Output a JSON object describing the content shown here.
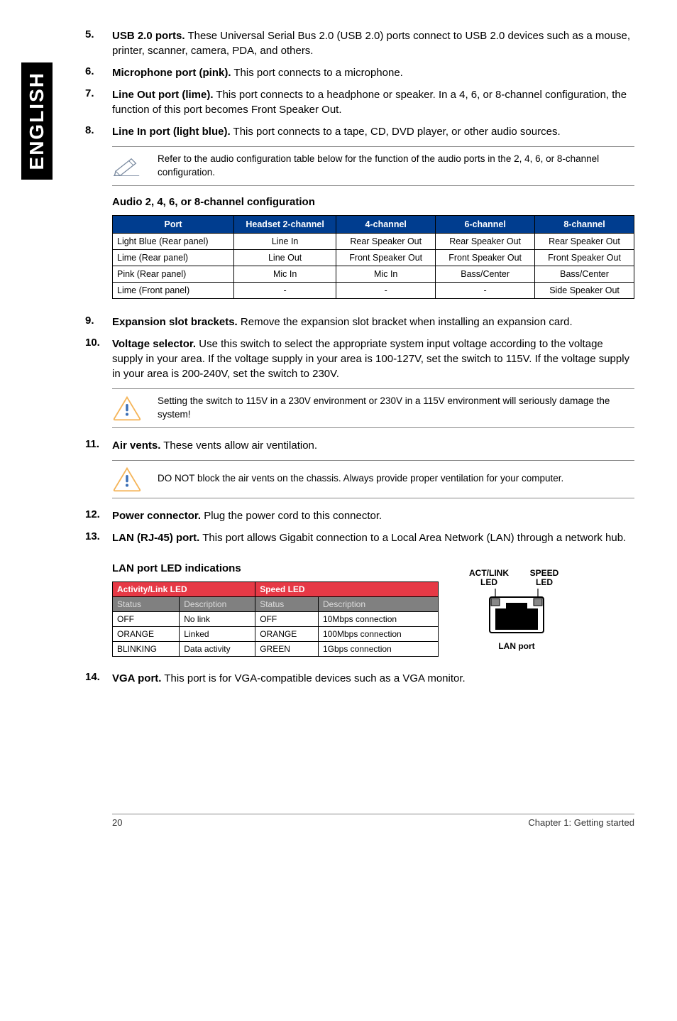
{
  "sidebar": {
    "label": "ENGLISH"
  },
  "items": {
    "5": {
      "num": "5.",
      "title": "USB 2.0 ports.",
      "text": "These Universal Serial Bus 2.0 (USB 2.0) ports connect to USB 2.0 devices such as a mouse, printer, scanner, camera, PDA, and others."
    },
    "6": {
      "num": "6.",
      "title": "Microphone port (pink).",
      "text": "This port connects to a microphone."
    },
    "7": {
      "num": "7.",
      "title": "Line Out port (lime).",
      "text": "This port connects to a headphone or speaker. In a 4, 6, or 8-channel configuration, the function of this port becomes Front Speaker Out."
    },
    "8": {
      "num": "8.",
      "title": "Line In port (light blue).",
      "text": "This port connects to a tape, CD, DVD player, or other audio sources."
    },
    "9": {
      "num": "9.",
      "title": "Expansion slot brackets.",
      "text": "Remove the expansion slot bracket when installing an expansion card."
    },
    "10": {
      "num": "10.",
      "title": "Voltage selector.",
      "text": "Use this switch to select the appropriate system input voltage according to the voltage supply in your area. If the voltage supply in your area is 100-127V, set the switch to 115V. If the voltage supply in your area is 200-240V, set the switch to 230V."
    },
    "11": {
      "num": "11.",
      "title": "Air vents.",
      "text": "These vents allow air ventilation."
    },
    "12": {
      "num": "12.",
      "title": "Power connector.",
      "text": "Plug the power cord to this connector."
    },
    "13": {
      "num": "13.",
      "title": "LAN (RJ-45) port.",
      "text": "This port allows Gigabit connection to a Local Area Network (LAN) through a network hub."
    },
    "14": {
      "num": "14.",
      "title": "VGA port.",
      "text": "This port is for VGA-compatible devices such as a VGA monitor."
    }
  },
  "notes": {
    "audio": "Refer to the audio configuration table below for the function of the audio ports in the 2, 4, 6, or 8-channel configuration.",
    "voltage": "Setting the switch to 115V in a 230V environment or 230V in a 115V environment will seriously damage the system!",
    "airvent": "DO NOT block the air vents on the chassis. Always provide proper ventilation for your computer."
  },
  "audio_table": {
    "title": "Audio 2, 4, 6, or 8-channel configuration",
    "headers": [
      "Port",
      "Headset 2-channel",
      "4-channel",
      "6-channel",
      "8-channel"
    ],
    "rows": [
      [
        "Light Blue (Rear panel)",
        "Line In",
        "Rear Speaker Out",
        "Rear Speaker Out",
        "Rear Speaker Out"
      ],
      [
        "Lime (Rear panel)",
        "Line Out",
        "Front Speaker Out",
        "Front Speaker Out",
        "Front Speaker Out"
      ],
      [
        "Pink (Rear panel)",
        "Mic In",
        "Mic In",
        "Bass/Center",
        "Bass/Center"
      ],
      [
        "Lime (Front panel)",
        "-",
        "-",
        "-",
        "Side Speaker Out"
      ]
    ]
  },
  "led": {
    "title": "LAN port LED indications",
    "top_headers": [
      "Activity/Link LED",
      "Speed LED"
    ],
    "sub_headers": [
      "Status",
      "Description",
      "Status",
      "Description"
    ],
    "rows": [
      [
        "OFF",
        "No link",
        "OFF",
        "10Mbps connection"
      ],
      [
        "ORANGE",
        "Linked",
        "ORANGE",
        "100Mbps connection"
      ],
      [
        "BLINKING",
        "Data activity",
        "GREEN",
        "1Gbps connection"
      ]
    ]
  },
  "lan_diagram": {
    "left_top": "ACT/LINK",
    "left_bot": "LED",
    "right_top": "SPEED",
    "right_bot": "LED",
    "caption": "LAN port"
  },
  "footer": {
    "page": "20",
    "chapter": "Chapter 1: Getting started"
  }
}
